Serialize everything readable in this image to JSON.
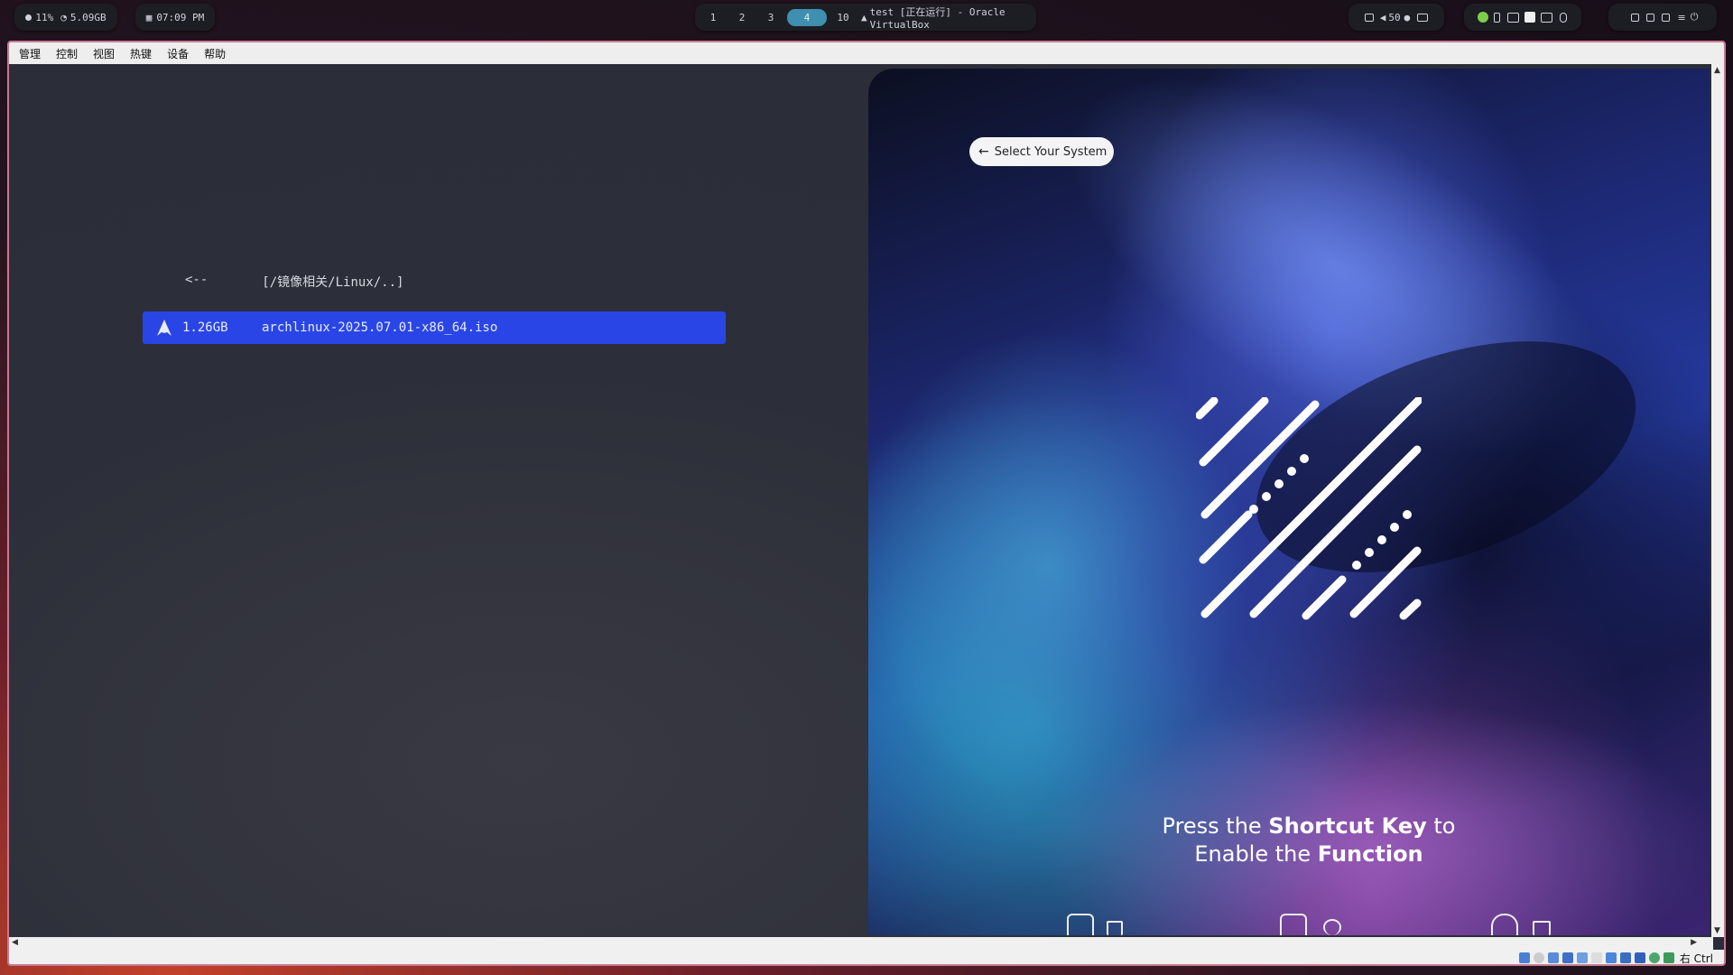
{
  "topbar": {
    "sys": {
      "cpu": "11%",
      "mem": "5.09GB"
    },
    "clock": "07:09 PM",
    "workspaces": [
      "1",
      "2",
      "3",
      "4",
      "10"
    ],
    "active_workspace": "4",
    "window_title": "test [正在运行] - Oracle VirtualBox",
    "volume": "50"
  },
  "vm": {
    "menu": [
      "管理",
      "控制",
      "视图",
      "热键",
      "设备",
      "帮助"
    ],
    "status_host_key": "右 Ctrl"
  },
  "browser": {
    "parent_arrow": "<--",
    "parent_path": "[/镜像相关/Linux/..]",
    "selected": {
      "size": "1.26GB",
      "name": "archlinux-2025.07.01-x86_64.iso"
    },
    "accent": "#2a45e6"
  },
  "panel": {
    "select_system": "Select Your System",
    "press_1": "Press the ",
    "press_bold_1": "Shortcut Key",
    "press_2": " to",
    "press_3": "Enable the ",
    "press_bold_2": "Function"
  }
}
